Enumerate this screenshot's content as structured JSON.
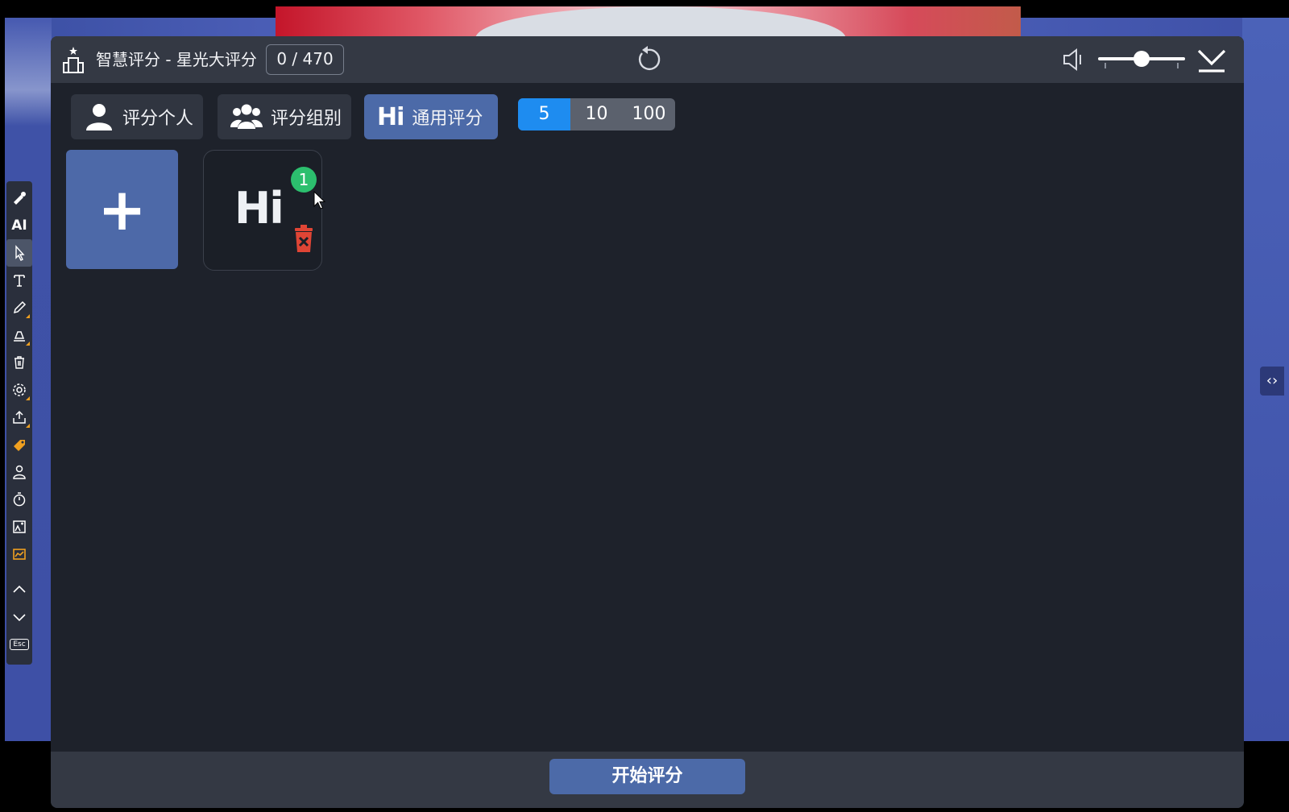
{
  "dialog": {
    "title": "智慧评分 - 星光大评分",
    "count": "0 / 470",
    "icons": {
      "app": "podium-icon",
      "refresh": "refresh-icon",
      "speaker": "speaker-icon",
      "collapse": "collapse-down-icon"
    },
    "volume": 0.5
  },
  "tabs": [
    {
      "label": "评分个人",
      "icon": "person-icon",
      "active": false
    },
    {
      "label": "评分组别",
      "icon": "group-icon",
      "active": false
    },
    {
      "label": "通用评分",
      "icon_text": "Hi",
      "active": true
    }
  ],
  "score_scale": {
    "options": [
      "5",
      "10",
      "100"
    ],
    "selected": "5"
  },
  "items": {
    "add_label": "+",
    "card_text": "Hi",
    "badge": "1"
  },
  "footer": {
    "start_label": "开始评分"
  },
  "toolbar": {
    "ai_label": "AI",
    "esc_label": "Esc",
    "tools": [
      "laser-pointer-icon",
      "ai-icon",
      "cursor-icon",
      "text-icon",
      "pen-icon",
      "eraser-icon",
      "trash-icon",
      "settings-icon",
      "export-icon",
      "tag-icon",
      "person-icon",
      "timer-icon",
      "image-icon",
      "chart-icon",
      "chevron-up-icon",
      "chevron-down-icon",
      "esc-icon"
    ]
  },
  "colors": {
    "dialog_bg": "#1e222b",
    "titlebar_bg": "#343944",
    "accent": "#4c6aa8",
    "segment_selected": "#1e8cf0",
    "badge": "#2cbf6e",
    "delete": "#e04535"
  }
}
